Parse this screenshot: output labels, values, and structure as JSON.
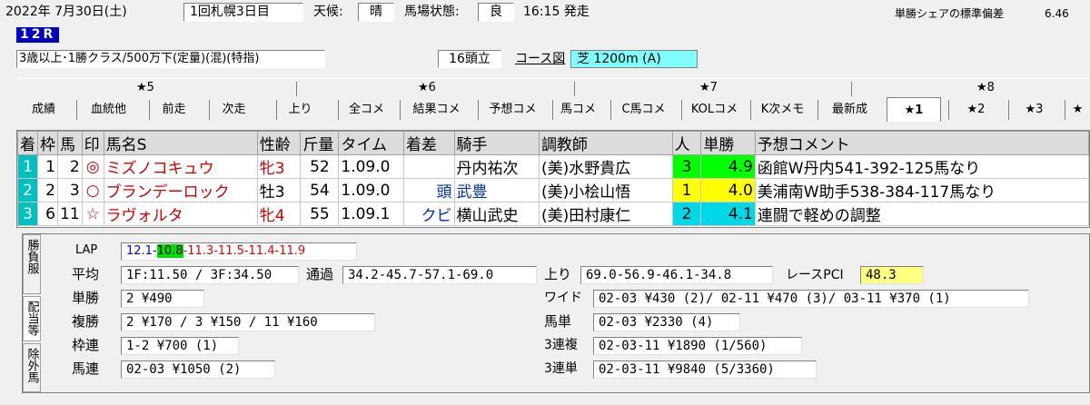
{
  "header": {
    "date": "2022年  7月30日(土)",
    "meeting": "1回札幌3日目",
    "weather_label": "天候:",
    "weather_value": "晴",
    "track_label": "馬場状態:",
    "track_value": "良",
    "post_time": "16:15 発走",
    "stddev_label": "単勝シェアの標準偏差",
    "stddev_value": "6.46",
    "race_number": "12R",
    "race_class": "3歳以上･1勝クラス/500万下(定量)(混)(特指)",
    "runners": "16頭立",
    "course_link": "コース図",
    "course_value": "芝 1200m (A)"
  },
  "star_groups": [
    {
      "label": "★5"
    },
    {
      "label": "★6"
    },
    {
      "label": "★7"
    },
    {
      "label": "★8"
    }
  ],
  "tabs": [
    {
      "label": "成績"
    },
    {
      "label": "血統他"
    },
    {
      "label": "前走"
    },
    {
      "label": "次走"
    },
    {
      "label": "上り"
    },
    {
      "label": "全コメ"
    },
    {
      "label": "結果コメ"
    },
    {
      "label": "予想コメ"
    },
    {
      "label": "馬コメ"
    },
    {
      "label": "C馬コメ"
    },
    {
      "label": "KOLコメ"
    },
    {
      "label": "K次メモ"
    },
    {
      "label": "最新成"
    },
    {
      "label": "★1"
    },
    {
      "label": "★2"
    },
    {
      "label": "★3"
    },
    {
      "label": "★"
    }
  ],
  "table": {
    "headers": [
      "着",
      "枠",
      "馬",
      "印",
      "馬名S",
      "性齢",
      "斤量",
      "タイム",
      "着差",
      "騎手",
      "調教師",
      "人",
      "単勝",
      "予想コメント"
    ],
    "rows": [
      {
        "pos": "1",
        "waku": "1",
        "uma": "2",
        "mark": "◎",
        "name": "ミズノコキュウ",
        "sex": "牝3",
        "weight": "52",
        "time": "1.09.0",
        "margin": "",
        "jockey": "丹内祐次",
        "trainer": "(美)水野貴広",
        "pop": "3",
        "odds": "4.9",
        "comment": "函館W丹内541-392-125馬なり"
      },
      {
        "pos": "2",
        "waku": "2",
        "uma": "3",
        "mark": "○",
        "name": "ブランデーロック",
        "sex": "牡3",
        "weight": "54",
        "time": "1.09.0",
        "margin": "頭",
        "jockey": "武豊",
        "trainer": "(美)小桧山悟",
        "pop": "1",
        "odds": "4.0",
        "comment": "美浦南W助手538-384-117馬なり"
      },
      {
        "pos": "3",
        "waku": "6",
        "uma": "11",
        "mark": "☆",
        "name": "ラヴォルタ",
        "sex": "牝4",
        "weight": "55",
        "time": "1.09.1",
        "margin": "クビ",
        "jockey": "横山武史",
        "trainer": "(美)田村康仁",
        "pop": "2",
        "odds": "4.1",
        "comment": "連闘で軽めの調整"
      }
    ]
  },
  "side_tabs": {
    "result": "勝負服",
    "payout": "配当等",
    "excluded": "除外馬"
  },
  "summary": {
    "lap_label": "LAP",
    "lap_part1": "12.1-",
    "lap_part2": "10.8",
    "lap_part3": "-11.3-11.5-11.4-11.9",
    "avg_label": "平均",
    "avg_value": "1F:11.50 / 3F:34.50",
    "passing_label": "通過",
    "passing_value": "34.2-45.7-57.1-69.0",
    "last_label": "上り",
    "last_value": "69.0-56.9-46.1-34.8",
    "pci_label": "レースPCI",
    "pci_value": "48.3",
    "win_label": "単勝",
    "win_value": "2 ¥490",
    "place_label": "複勝",
    "place_value": "2 ¥170 / 3 ¥150 / 11 ¥160",
    "bracket_label": "枠連",
    "bracket_value": "1-2 ¥700 (1)",
    "quinella_label": "馬連",
    "quinella_value": "02-03 ¥1050 (2)",
    "wide_label": "ワイド",
    "wide_value": "02-03 ¥430 (2)/ 02-11 ¥470 (3)/ 03-11 ¥370 (1)",
    "exacta_label": "馬単",
    "exacta_value": "02-03 ¥2330 (4)",
    "trio_label": "3連複",
    "trio_value": "02-03-11 ¥1890 (1/560)",
    "trifecta_label": "3連単",
    "trifecta_value": "02-03-11 ¥9840 (5/3360)"
  }
}
